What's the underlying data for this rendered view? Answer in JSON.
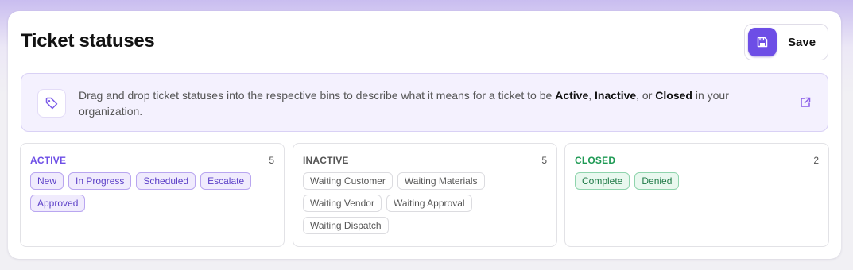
{
  "page": {
    "title": "Ticket statuses",
    "save_label": "Save",
    "save_icon": "floppy-disk-icon"
  },
  "info": {
    "icon": "tag-icon",
    "text_1": "Drag and drop ticket statuses into the respective bins to describe what it means for a ticket to be ",
    "bold_active": "Active",
    "sep_1": ", ",
    "bold_inactive": "Inactive",
    "sep_2": ", or ",
    "bold_closed": "Closed",
    "text_2": " in your organization.",
    "link_icon": "external-link-icon"
  },
  "bins": {
    "active": {
      "title": "ACTIVE",
      "count": "5",
      "color": "#6d4ee6",
      "statuses": [
        "New",
        "In Progress",
        "Scheduled",
        "Escalate",
        "Approved"
      ]
    },
    "inactive": {
      "title": "INACTIVE",
      "count": "5",
      "color": "#555555",
      "statuses": [
        "Waiting Customer",
        "Waiting Materials",
        "Waiting Vendor",
        "Waiting Approval",
        "Waiting Dispatch"
      ]
    },
    "closed": {
      "title": "CLOSED",
      "count": "2",
      "color": "#1f9a55",
      "statuses": [
        "Complete",
        "Denied"
      ]
    }
  },
  "colors": {
    "accent": "#6d4ee6",
    "info_bg": "#f4f1fe"
  }
}
